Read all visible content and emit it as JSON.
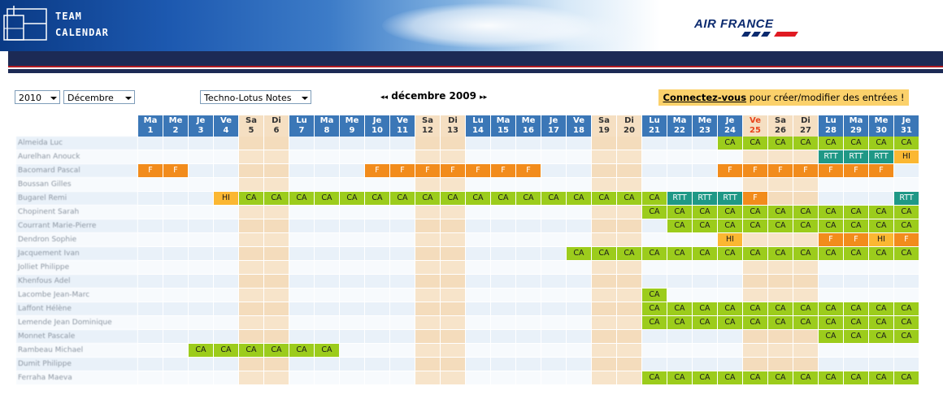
{
  "header": {
    "logo_line1": "TEAM",
    "logo_line2": "CALENDAR",
    "brand": "AIR FRANCE"
  },
  "controls": {
    "year": "2010",
    "month": "Décembre",
    "group": "Techno-Lotus Notes",
    "nav_prev": "◂◂",
    "month_title": "décembre 2009",
    "nav_next": "▸▸",
    "login_link": "Connectez-vous",
    "login_text": " pour créer/modifier des entrées !"
  },
  "colors": {
    "CA": "#9ccc1c",
    "F": "#f28c1c",
    "HI": "#fbb732",
    "RTT": "#1f9886",
    "weekday_header": "#3b77b7",
    "weekend_col": "#f5dfc2"
  },
  "calendar": {
    "days": [
      {
        "d": "Ma",
        "n": "1"
      },
      {
        "d": "Me",
        "n": "2"
      },
      {
        "d": "Je",
        "n": "3"
      },
      {
        "d": "Ve",
        "n": "4"
      },
      {
        "d": "Sa",
        "n": "5"
      },
      {
        "d": "Di",
        "n": "6"
      },
      {
        "d": "Lu",
        "n": "7"
      },
      {
        "d": "Ma",
        "n": "8"
      },
      {
        "d": "Me",
        "n": "9"
      },
      {
        "d": "Je",
        "n": "10"
      },
      {
        "d": "Ve",
        "n": "11"
      },
      {
        "d": "Sa",
        "n": "12"
      },
      {
        "d": "Di",
        "n": "13"
      },
      {
        "d": "Lu",
        "n": "14"
      },
      {
        "d": "Ma",
        "n": "15"
      },
      {
        "d": "Me",
        "n": "16"
      },
      {
        "d": "Je",
        "n": "17"
      },
      {
        "d": "Ve",
        "n": "18"
      },
      {
        "d": "Sa",
        "n": "19"
      },
      {
        "d": "Di",
        "n": "20"
      },
      {
        "d": "Lu",
        "n": "21"
      },
      {
        "d": "Ma",
        "n": "22"
      },
      {
        "d": "Me",
        "n": "23"
      },
      {
        "d": "Je",
        "n": "24"
      },
      {
        "d": "Ve",
        "n": "25"
      },
      {
        "d": "Sa",
        "n": "26"
      },
      {
        "d": "Di",
        "n": "27"
      },
      {
        "d": "Lu",
        "n": "28"
      },
      {
        "d": "Ma",
        "n": "29"
      },
      {
        "d": "Me",
        "n": "30"
      },
      {
        "d": "Je",
        "n": "31"
      }
    ],
    "weekend_days": [
      5,
      6,
      12,
      13,
      19,
      20,
      26,
      27
    ],
    "holiday_days": [
      25
    ],
    "rows": [
      {
        "name": "Almeida Luc",
        "entries": {
          "24": "CA",
          "25": "CA",
          "26": "CA",
          "27": "CA",
          "28": "CA",
          "29": "CA",
          "30": "CA",
          "31": "CA"
        }
      },
      {
        "name": "Aurelhan Anouck",
        "entries": {
          "28": "RTT",
          "29": "RTT",
          "30": "RTT",
          "31": "HI"
        }
      },
      {
        "name": "Bacomard Pascal",
        "entries": {
          "1": "F",
          "2": "F",
          "10": "F",
          "11": "F",
          "12": "F",
          "13": "F",
          "14": "F",
          "15": "F",
          "16": "F",
          "24": "F",
          "25": "F",
          "26": "F",
          "27": "F",
          "28": "F",
          "29": "F",
          "30": "F"
        }
      },
      {
        "name": "Boussan Gilles",
        "entries": {}
      },
      {
        "name": "Bugarel Remi",
        "entries": {
          "4": "HI",
          "5": "CA",
          "6": "CA",
          "7": "CA",
          "8": "CA",
          "9": "CA",
          "10": "CA",
          "11": "CA",
          "12": "CA",
          "13": "CA",
          "14": "CA",
          "15": "CA",
          "16": "CA",
          "17": "CA",
          "18": "CA",
          "19": "CA",
          "20": "CA",
          "21": "CA",
          "22": "RTT",
          "23": "RTT",
          "24": "RTT",
          "25": "F",
          "31": "RTT"
        }
      },
      {
        "name": "Chopinent Sarah",
        "entries": {
          "21": "CA",
          "22": "CA",
          "23": "CA",
          "24": "CA",
          "25": "CA",
          "26": "CA",
          "27": "CA",
          "28": "CA",
          "29": "CA",
          "30": "CA",
          "31": "CA"
        }
      },
      {
        "name": "Courrant Marie-Pierre",
        "entries": {
          "22": "CA",
          "23": "CA",
          "24": "CA",
          "25": "CA",
          "26": "CA",
          "27": "CA",
          "28": "CA",
          "29": "CA",
          "30": "CA",
          "31": "CA"
        }
      },
      {
        "name": "Dendron Sophie",
        "entries": {
          "24": "HI",
          "28": "F",
          "29": "F",
          "30": "HI",
          "31": "F"
        }
      },
      {
        "name": "Jacquement Ivan",
        "entries": {
          "18": "CA",
          "19": "CA",
          "20": "CA",
          "21": "CA",
          "22": "CA",
          "23": "CA",
          "24": "CA",
          "25": "CA",
          "26": "CA",
          "27": "CA",
          "28": "CA",
          "29": "CA",
          "30": "CA",
          "31": "CA"
        }
      },
      {
        "name": "Jolliet Philippe",
        "entries": {}
      },
      {
        "name": "Khenfous Adel",
        "entries": {}
      },
      {
        "name": "Lacombe Jean-Marc",
        "entries": {
          "21": "CA"
        }
      },
      {
        "name": "Laffont Hélène",
        "entries": {
          "21": "CA",
          "22": "CA",
          "23": "CA",
          "24": "CA",
          "25": "CA",
          "26": "CA",
          "27": "CA",
          "28": "CA",
          "29": "CA",
          "30": "CA",
          "31": "CA"
        }
      },
      {
        "name": "Lemende Jean Dominique",
        "entries": {
          "21": "CA",
          "22": "CA",
          "23": "CA",
          "24": "CA",
          "25": "CA",
          "26": "CA",
          "27": "CA",
          "28": "CA",
          "29": "CA",
          "30": "CA",
          "31": "CA"
        }
      },
      {
        "name": "Monnet Pascale",
        "entries": {
          "28": "CA",
          "29": "CA",
          "30": "CA",
          "31": "CA"
        }
      },
      {
        "name": "Rambeau Michael",
        "entries": {
          "3": "CA",
          "4": "CA",
          "5": "CA",
          "6": "CA",
          "7": "CA",
          "8": "CA"
        }
      },
      {
        "name": "Dumit Philippe",
        "entries": {}
      },
      {
        "name": "Ferraha Maeva",
        "entries": {
          "21": "CA",
          "22": "CA",
          "23": "CA",
          "24": "CA",
          "25": "CA",
          "26": "CA",
          "27": "CA",
          "28": "CA",
          "29": "CA",
          "30": "CA",
          "31": "CA"
        }
      }
    ]
  }
}
